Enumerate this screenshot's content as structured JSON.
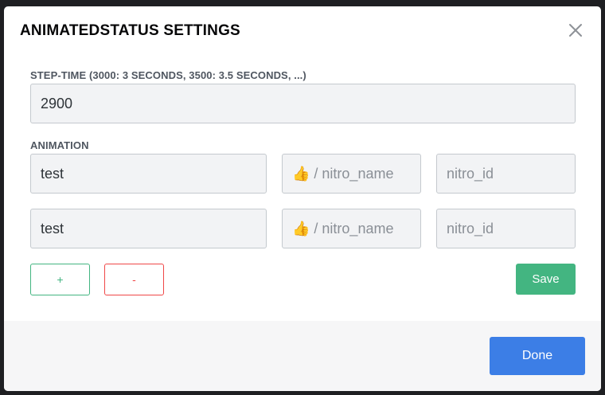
{
  "modal": {
    "title": "ANIMATEDSTATUS SETTINGS",
    "close_icon": "close-icon"
  },
  "step_time": {
    "label": "STEP-TIME (3000: 3 SECONDS, 3500: 3.5 SECONDS, ...)",
    "value": "2900"
  },
  "animation": {
    "label": "ANIMATION",
    "rows": [
      {
        "text": "test",
        "emoji_placeholder": "👍 / nitro_name",
        "id_placeholder": "nitro_id"
      },
      {
        "text": "test",
        "emoji_placeholder": "👍 / nitro_name",
        "id_placeholder": "nitro_id"
      }
    ]
  },
  "buttons": {
    "add": "+",
    "remove": "-",
    "save": "Save",
    "done": "Done"
  },
  "colors": {
    "accent_green": "#43b581",
    "danger_red": "#f04747",
    "brand_blue": "#3c7ee6"
  }
}
